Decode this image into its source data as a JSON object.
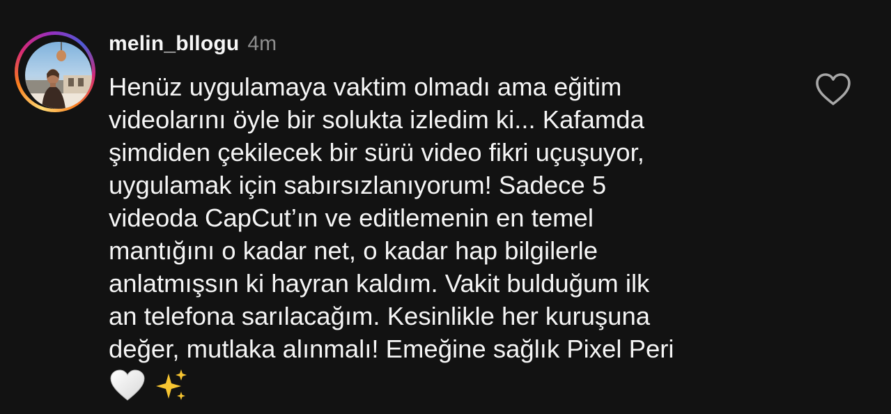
{
  "comment": {
    "username": "melin_bllogu",
    "time": "4m",
    "lines": [
      "Henüz uygulamaya vaktim olmadı ama eğitim",
      "videolarını öyle bir solukta izledim ki... Kafamda",
      "şimdiden çekilecek bir sürü video fikri uçuşuyor,",
      "uygulamak için sabırsızlanıyorum! Sadece 5",
      "videoda CapCut’ın ve editlemenin en temel",
      "mantığını o kadar net, o kadar hap bilgilerle",
      "anlatmışsın ki hayran kaldım. Vakit bulduğum ilk",
      "an telefona sarılacağım. Kesinlikle her kuruşuna",
      "değer, mutlaka alınmalı! Emeğine sağlık Pixel Peri"
    ],
    "emojis": [
      "white-heart-emoji",
      "sparkles-emoji"
    ]
  },
  "icons": {
    "like": "heart-outline-icon"
  },
  "colors": {
    "background": "#121212",
    "text": "#f5f5f5",
    "muted": "#8e8e8e",
    "story_ring": [
      "#feda75",
      "#fa7e1e",
      "#d62976",
      "#962fbf",
      "#4f5bd5"
    ]
  }
}
